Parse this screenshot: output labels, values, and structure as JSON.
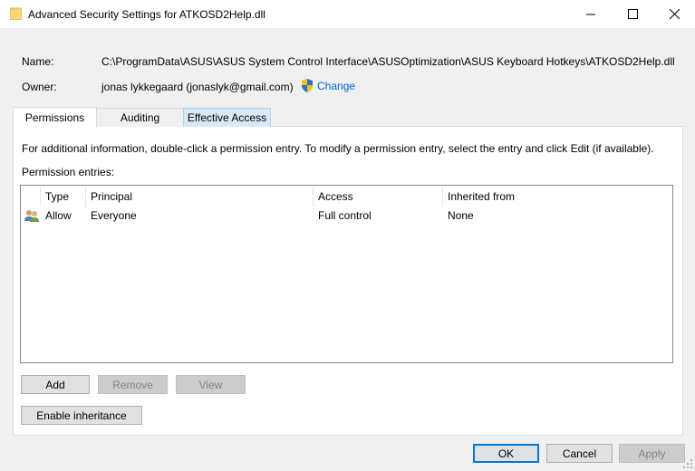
{
  "window": {
    "title": "Advanced Security Settings for ATKOSD2Help.dll"
  },
  "details": {
    "name_label": "Name:",
    "name_value": "C:\\ProgramData\\ASUS\\ASUS System Control Interface\\ASUSOptimization\\ASUS Keyboard Hotkeys\\ATKOSD2Help.dll",
    "owner_label": "Owner:",
    "owner_value": "jonas lykkegaard (jonaslyk@gmail.com)",
    "change_label": "Change"
  },
  "tabs": [
    {
      "label": "Permissions",
      "selected": true
    },
    {
      "label": "Auditing",
      "selected": false
    },
    {
      "label": "Effective Access",
      "selected": false
    }
  ],
  "permissions": {
    "info_text": "For additional information, double-click a permission entry. To modify a permission entry, select the entry and click Edit (if available).",
    "entries_label": "Permission entries:",
    "columns": [
      "Type",
      "Principal",
      "Access",
      "Inherited from"
    ],
    "rows": [
      {
        "type": "Allow",
        "principal": "Everyone",
        "access": "Full control",
        "inherited_from": "None",
        "icon": "users-icon"
      }
    ]
  },
  "buttons": {
    "add": "Add",
    "remove": "Remove",
    "view": "View",
    "enable_inheritance": "Enable inheritance",
    "ok": "OK",
    "cancel": "Cancel",
    "apply": "Apply"
  },
  "colors": {
    "link": "#0066cc",
    "accent": "#0078d7",
    "effective_tab": "#d9e8f7"
  }
}
